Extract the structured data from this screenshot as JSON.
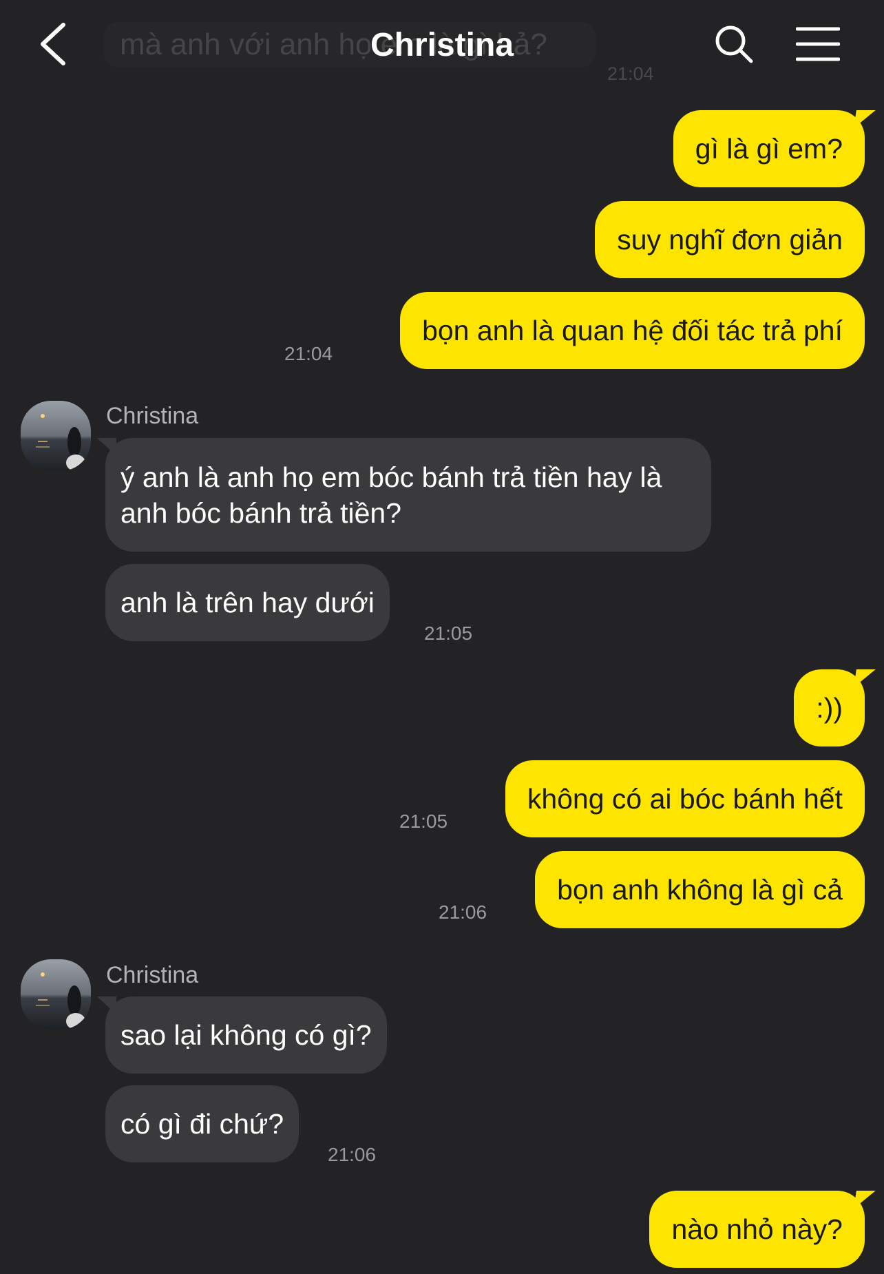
{
  "header": {
    "title": "Christina",
    "partial_message": "mà anh với anh họ em là gì hả?",
    "partial_time": "21:04"
  },
  "messages": [
    {
      "side": "me",
      "text": "gì là gì em?"
    },
    {
      "side": "me",
      "text": "suy nghĩ đơn giản"
    },
    {
      "side": "me",
      "text": "bọn anh là quan hệ đối tác trả phí",
      "time": "21:04"
    },
    {
      "side": "them",
      "sender": "Christina",
      "text": "ý anh là anh họ em bóc bánh trả tiền hay là anh bóc bánh trả tiền?"
    },
    {
      "side": "them",
      "text": "anh là trên hay dưới",
      "time": "21:05"
    },
    {
      "side": "me",
      "text": ":))"
    },
    {
      "side": "me",
      "text": "không có ai bóc bánh hết",
      "time": "21:05"
    },
    {
      "side": "me",
      "text": "bọn anh không là gì cả",
      "time": "21:06"
    },
    {
      "side": "them",
      "sender": "Christina",
      "text": "sao lại không có gì?"
    },
    {
      "side": "them",
      "text": "có gì đi chứ?",
      "time": "21:06"
    },
    {
      "side": "me",
      "text": "nào nhỏ này?"
    }
  ],
  "colors": {
    "background": "#232325",
    "my_bubble": "#fde500",
    "their_bubble": "#3a3a3c"
  },
  "icons": {
    "back": "chevron-left-icon",
    "search": "search-icon",
    "menu": "hamburger-menu-icon"
  }
}
